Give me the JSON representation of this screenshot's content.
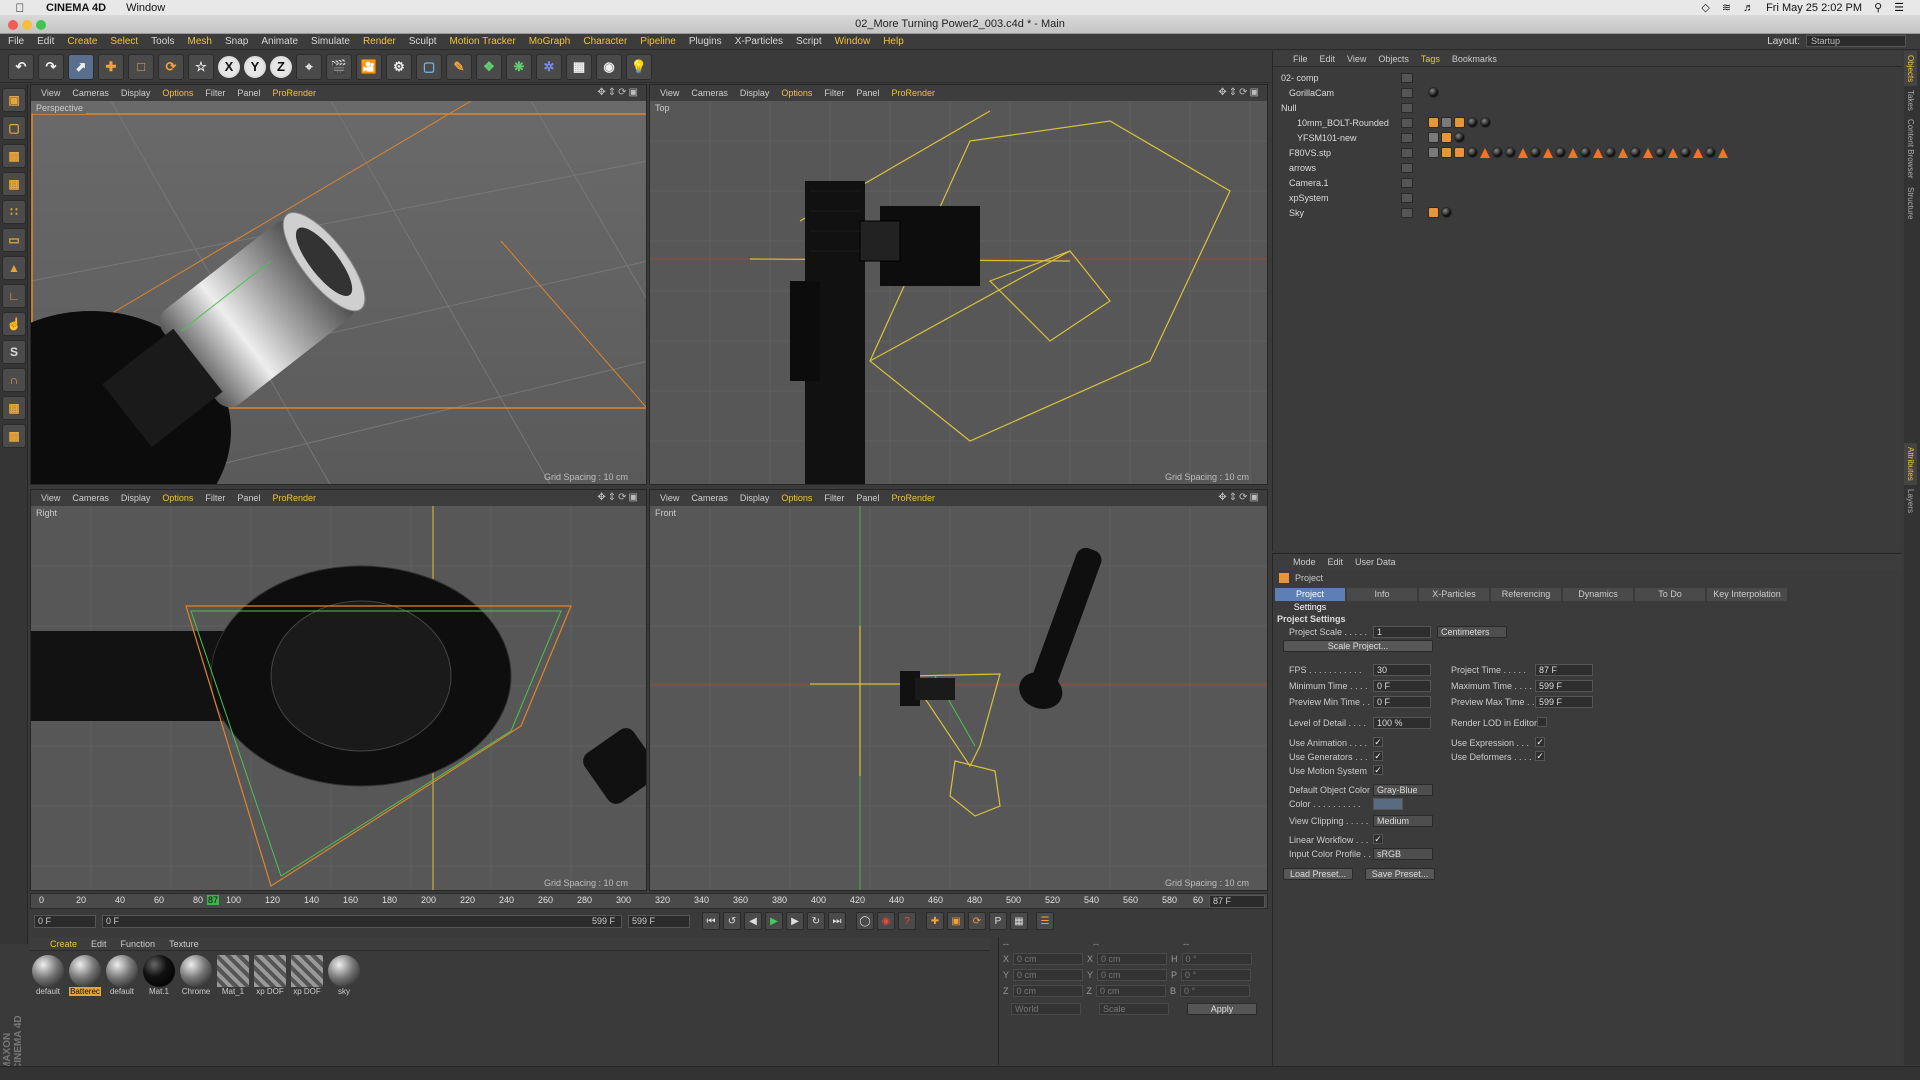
{
  "mac_menubar": {
    "app": "CINEMA 4D",
    "window_menu": "Window",
    "clock": "Fri May 25  2:02 PM"
  },
  "window_title": "02_More Turning Power2_003.c4d * - Main",
  "main_menu": [
    "File",
    "Edit",
    "Create",
    "Select",
    "Tools",
    "Mesh",
    "Snap",
    "Animate",
    "Simulate",
    "Render",
    "Sculpt",
    "Motion Tracker",
    "MoGraph",
    "Character",
    "Pipeline",
    "Plugins",
    "X-Particles",
    "Script",
    "Window",
    "Help"
  ],
  "layout": {
    "label": "Layout:",
    "value": "Startup"
  },
  "toolbar": {
    "x_label": "X",
    "y_label": "Y",
    "z_label": "Z"
  },
  "viewport_menu": {
    "view": "View",
    "cameras": "Cameras",
    "display": "Display",
    "options": "Options",
    "filter": "Filter",
    "panel": "Panel",
    "prorender": "ProRender"
  },
  "viewports": [
    {
      "name": "Perspective",
      "grid": "Grid Spacing : 10 cm"
    },
    {
      "name": "Top",
      "grid": "Grid Spacing : 10 cm"
    },
    {
      "name": "Right",
      "grid": "Grid Spacing : 10 cm"
    },
    {
      "name": "Front",
      "grid": "Grid Spacing : 10 cm"
    }
  ],
  "timeline": {
    "ticks": [
      "0",
      "20",
      "40",
      "60",
      "80",
      "87",
      "100",
      "120",
      "140",
      "160",
      "180",
      "200",
      "220",
      "240",
      "260",
      "280",
      "300",
      "320",
      "340",
      "360",
      "380",
      "400",
      "420",
      "440",
      "460",
      "480",
      "500",
      "520",
      "540",
      "560",
      "580",
      "60"
    ],
    "current_frame": "87 F",
    "start_field": "0 F",
    "start_field2": "0 F",
    "end_field": "599 F",
    "end_field2": "599 F"
  },
  "material_menu": [
    "Create",
    "Edit",
    "Function",
    "Texture"
  ],
  "materials": [
    {
      "label": "default",
      "style": "ball"
    },
    {
      "label": "Batterec",
      "style": "ball",
      "selected": true
    },
    {
      "label": "default",
      "style": "ball"
    },
    {
      "label": "Mat.1",
      "style": "black"
    },
    {
      "label": "Chrome",
      "style": "ball"
    },
    {
      "label": "Mat_1",
      "style": "stripe"
    },
    {
      "label": "xp DOF",
      "style": "stripe"
    },
    {
      "label": "xp DOF",
      "style": "stripe"
    },
    {
      "label": "sky",
      "style": "ball"
    }
  ],
  "coordinates": {
    "header": [
      "--",
      "--",
      "--"
    ],
    "rows": [
      {
        "a": "X",
        "av": "0 cm",
        "b": "X",
        "bv": "0 cm",
        "c": "H",
        "cv": "0 °"
      },
      {
        "a": "Y",
        "av": "0 cm",
        "b": "Y",
        "bv": "0 cm",
        "c": "P",
        "cv": "0 °"
      },
      {
        "a": "Z",
        "av": "0 cm",
        "b": "Z",
        "bv": "0 cm",
        "c": "B",
        "cv": "0 °"
      }
    ],
    "world": "World",
    "scale": "Scale",
    "apply": "Apply"
  },
  "object_menu": [
    "File",
    "Edit",
    "View",
    "Objects",
    "Tags",
    "Bookmarks"
  ],
  "objects": [
    {
      "name": "02- comp",
      "indent": 0
    },
    {
      "name": "GorillaCam",
      "indent": 1
    },
    {
      "name": "Null",
      "indent": 0
    },
    {
      "name": "10mm_BOLT-Rounded",
      "indent": 2
    },
    {
      "name": "YFSM101-new",
      "indent": 2
    },
    {
      "name": "F80VS.stp",
      "indent": 1
    },
    {
      "name": "arrows",
      "indent": 1
    },
    {
      "name": "Camera.1",
      "indent": 1
    },
    {
      "name": "xpSystem",
      "indent": 1
    },
    {
      "name": "Sky",
      "indent": 1
    }
  ],
  "attr_menu": [
    "Mode",
    "Edit",
    "User Data"
  ],
  "attr": {
    "object": "Project",
    "tabs": [
      "Project Settings",
      "Info",
      "X-Particles",
      "Referencing",
      "Dynamics",
      "To Do",
      "Key Interpolation"
    ],
    "section": "Project Settings",
    "project_scale_label": "Project Scale . . . . .",
    "project_scale": "1",
    "project_unit": "Centimeters",
    "scale_project_btn": "Scale Project...",
    "fps_label": "FPS . . . . . . . . . . .",
    "fps": "30",
    "project_time_label": "Project Time . . . . .",
    "project_time": "87 F",
    "min_time_label": "Minimum Time . . . .",
    "min_time": "0 F",
    "max_time_label": "Maximum Time . . . .",
    "max_time": "599 F",
    "prev_min_label": "Preview Min Time . .",
    "prev_min": "0 F",
    "prev_max_label": "Preview Max Time . .",
    "prev_max": "599 F",
    "lod_label": "Level of Detail . . . .",
    "lod": "100 %",
    "render_lod_label": "Render LOD in Editor",
    "use_anim_label": "Use Animation . . . .",
    "use_expr_label": "Use Expression . . .",
    "use_gen_label": "Use Generators . . .",
    "use_def_label": "Use Deformers . . . .",
    "use_motion_label": "Use Motion System",
    "default_color_label": "Default Object Color",
    "default_color": "Gray-Blue",
    "color_label": "Color . . . . . . . . . .",
    "view_clipping_label": "View Clipping . . . . .",
    "view_clipping": "Medium",
    "linear_wf_label": "Linear Workflow . . .",
    "input_profile_label": "Input Color Profile . .",
    "input_profile": "sRGB",
    "load_preset": "Load Preset...",
    "save_preset": "Save Preset..."
  },
  "right_tabs": [
    "Objects",
    "Takes",
    "Content Browser",
    "Structure",
    "Attributes",
    "Layers"
  ],
  "maxon_logo": "MAXON CINEMA 4D",
  "colors": {
    "accent": "#f2c232",
    "selection": "#5d7fb3",
    "wire_orange": "#e0852a",
    "wire_yellow": "#d9c23a"
  }
}
